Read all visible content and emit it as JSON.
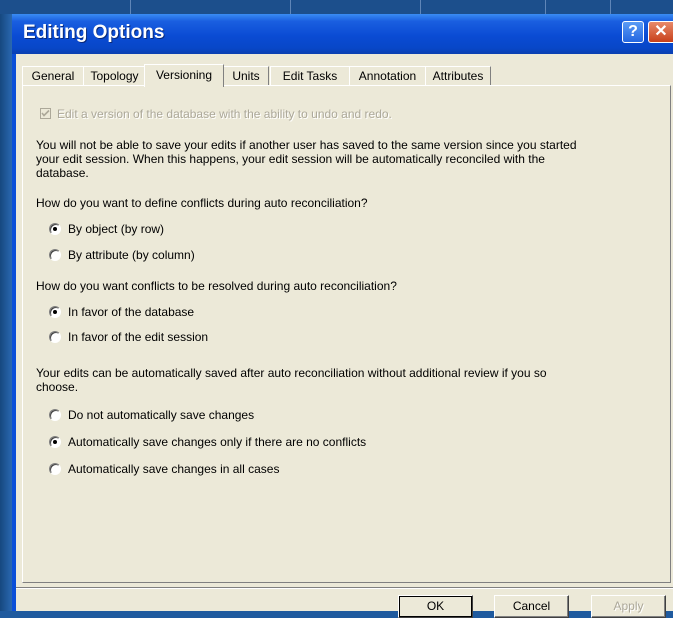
{
  "window": {
    "title": "Editing Options"
  },
  "titlebar": {
    "help_glyph": "?",
    "close_glyph": "✕"
  },
  "tabs": [
    {
      "label": "General"
    },
    {
      "label": "Topology"
    },
    {
      "label": "Versioning",
      "active": true
    },
    {
      "label": "Units"
    },
    {
      "label": "Edit Tasks"
    },
    {
      "label": "Annotation"
    },
    {
      "label": "Attributes"
    }
  ],
  "versioning": {
    "undo_checkbox_label": "Edit a version of the database with the ability to undo and redo.",
    "undo_checked": true,
    "warning_lines": [
      "You will not be able to save your edits if another user has saved to the same version since you started",
      "your edit session. When this happens, your edit session will be automatically reconciled with the",
      "database."
    ],
    "define_question": "How do you want to define conflicts during auto reconciliation?",
    "define_options": [
      {
        "label": "By object (by row)",
        "selected": true
      },
      {
        "label": "By attribute (by column)",
        "selected": false
      }
    ],
    "resolve_question": "How do you want conflicts to be resolved during auto reconciliation?",
    "resolve_options": [
      {
        "label": "In favor of the database",
        "selected": true
      },
      {
        "label": "In favor of the edit session",
        "selected": false
      }
    ],
    "save_lines": [
      "Your edits can be automatically saved after auto reconciliation without additional review if you so",
      "choose."
    ],
    "save_options": [
      {
        "label": "Do not automatically save changes",
        "selected": false
      },
      {
        "label": "Automatically save changes only if there are no conflicts",
        "selected": true
      },
      {
        "label": "Automatically save changes in all cases",
        "selected": false
      }
    ]
  },
  "buttons": {
    "ok": "OK",
    "cancel": "Cancel",
    "apply": "Apply"
  }
}
